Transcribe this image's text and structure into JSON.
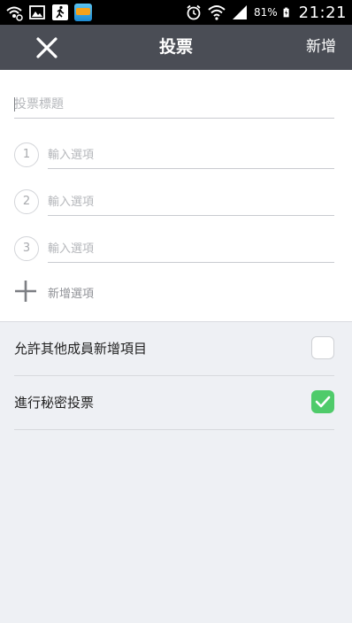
{
  "status_bar": {
    "battery_percent": "81%",
    "time": "21:21",
    "icons": [
      "wifi-call-icon",
      "gallery-icon",
      "running-app-icon",
      "game-app-icon",
      "alarm-icon",
      "wifi-icon",
      "signal-icon",
      "battery-charging-icon"
    ]
  },
  "header": {
    "title": "投票",
    "close_icon": "close-icon",
    "add_label": "新增"
  },
  "form": {
    "title_placeholder": "投票標題",
    "options": [
      {
        "number": "1",
        "placeholder": "輸入選項"
      },
      {
        "number": "2",
        "placeholder": "輸入選項"
      },
      {
        "number": "3",
        "placeholder": "輸入選項"
      }
    ],
    "add_option_label": "新增選項"
  },
  "settings": [
    {
      "label": "允許其他成員新增項目",
      "checked": false
    },
    {
      "label": "進行秘密投票",
      "checked": true
    }
  ],
  "colors": {
    "status_bar_bg": "#000000",
    "header_bg": "#4a4d55",
    "checkbox_on": "#4fcb6a",
    "page_bg": "#eef0f4"
  }
}
